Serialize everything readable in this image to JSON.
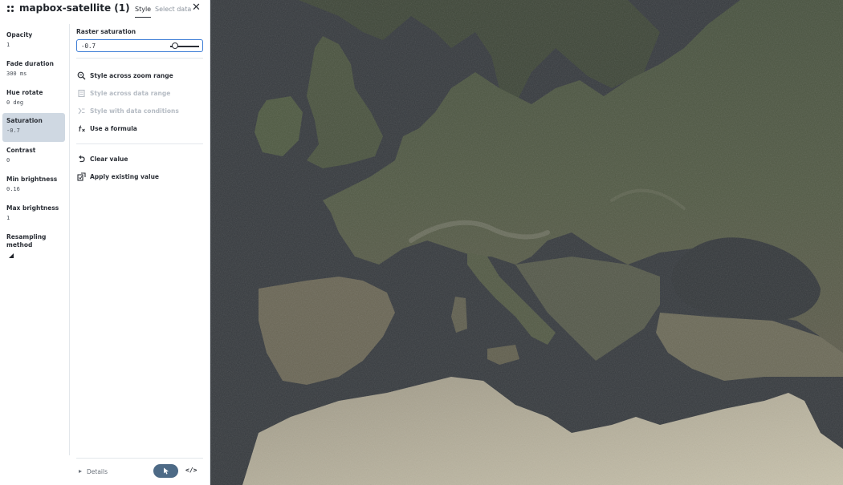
{
  "layer": {
    "title": "mapbox-satellite (1)"
  },
  "tabs": [
    {
      "label": "Style",
      "active": true
    },
    {
      "label": "Select data",
      "active": false
    }
  ],
  "properties": [
    {
      "name": "Opacity",
      "value": "1"
    },
    {
      "name": "Fade duration",
      "value": "300 ms"
    },
    {
      "name": "Hue rotate",
      "value": "0 deg"
    },
    {
      "name": "Saturation",
      "value": "-0.7",
      "selected": true
    },
    {
      "name": "Contrast",
      "value": "0"
    },
    {
      "name": "Min brightness",
      "value": "0.16"
    },
    {
      "name": "Max brightness",
      "value": "1"
    },
    {
      "name": "Resampling method",
      "value": ""
    }
  ],
  "editor": {
    "label": "Raster saturation",
    "value": "-0.7",
    "slider_value": -0.7,
    "slider_min": -1,
    "slider_max": 1
  },
  "actions": [
    {
      "label": "Style across zoom range",
      "icon": "zoom-range-icon",
      "enabled": true
    },
    {
      "label": "Style across data range",
      "icon": "data-range-icon",
      "enabled": false
    },
    {
      "label": "Style with data conditions",
      "icon": "data-conditions-icon",
      "enabled": false
    },
    {
      "label": "Use a formula",
      "icon": "formula-icon",
      "enabled": true
    }
  ],
  "value_actions": [
    {
      "label": "Clear value",
      "icon": "undo-icon"
    },
    {
      "label": "Apply existing value",
      "icon": "apply-value-icon"
    }
  ],
  "footer": {
    "details_label": "Details",
    "code_label": "</>"
  },
  "colors": {
    "selected_bg": "#cfd8e2",
    "input_focus": "#3a7bd5",
    "pointer_button": "#4d6a86",
    "map_water": "#363a3e"
  }
}
